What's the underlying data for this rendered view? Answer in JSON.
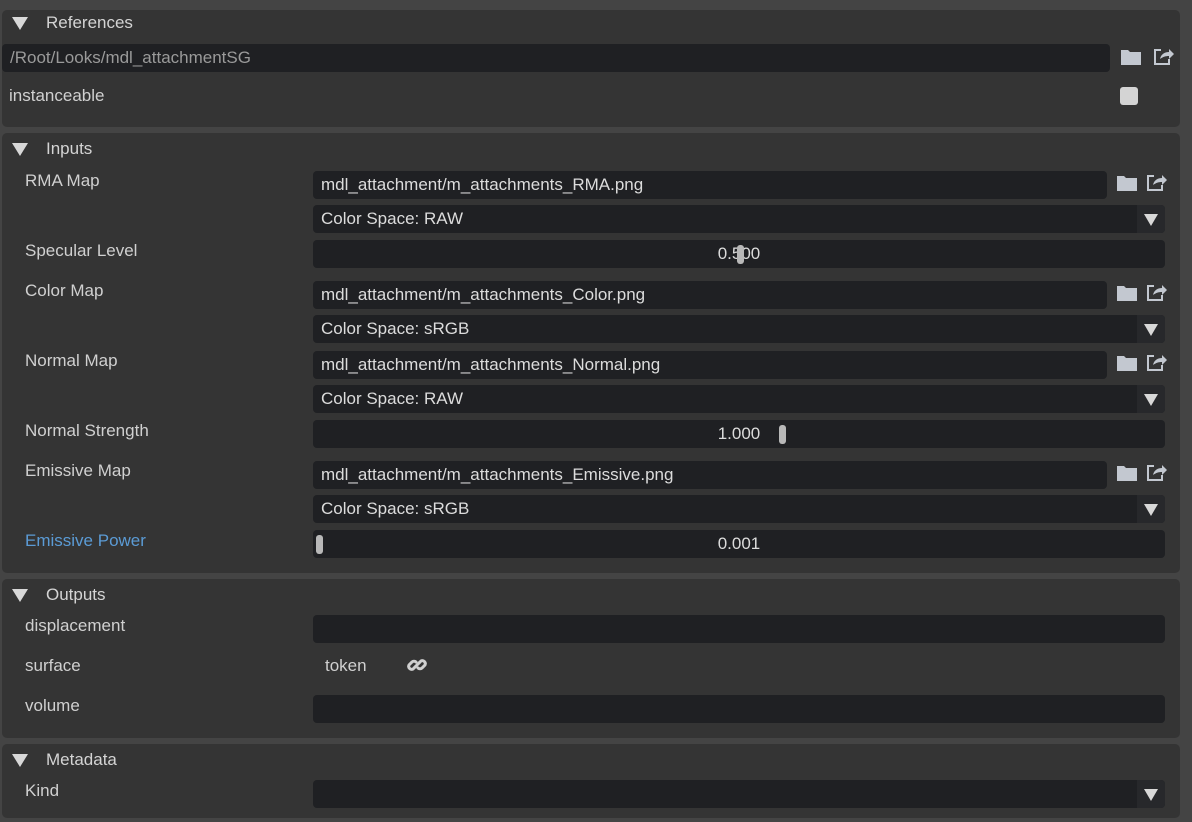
{
  "references": {
    "title": "References",
    "path": "/Root/Looks/mdl_attachmentSG",
    "instanceable_label": "instanceable",
    "instanceable_checked": false
  },
  "inputs": {
    "title": "Inputs",
    "rma_map": {
      "label": "RMA Map",
      "value": "mdl_attachment/m_attachments_RMA.png",
      "color_space": "Color Space: RAW"
    },
    "specular_level": {
      "label": "Specular Level",
      "value": "0.500",
      "fill": 0.5
    },
    "color_map": {
      "label": "Color Map",
      "value": "mdl_attachment/m_attachments_Color.png",
      "color_space": "Color Space: sRGB"
    },
    "normal_map": {
      "label": "Normal Map",
      "value": "mdl_attachment/m_attachments_Normal.png",
      "color_space": "Color Space: RAW"
    },
    "normal_strength": {
      "label": "Normal Strength",
      "value": "1.000",
      "fill": 0.55
    },
    "emissive_map": {
      "label": "Emissive Map",
      "value": "mdl_attachment/m_attachments_Emissive.png",
      "color_space": "Color Space: sRGB"
    },
    "emissive_power": {
      "label": "Emissive Power",
      "value": "0.001",
      "fill": 0.0,
      "label_color": "#5b9bd5"
    }
  },
  "outputs": {
    "title": "Outputs",
    "displacement": "displacement",
    "surface": "surface",
    "surface_value": "token",
    "volume": "volume"
  },
  "metadata": {
    "title": "Metadata",
    "kind": "Kind",
    "kind_value": ""
  }
}
